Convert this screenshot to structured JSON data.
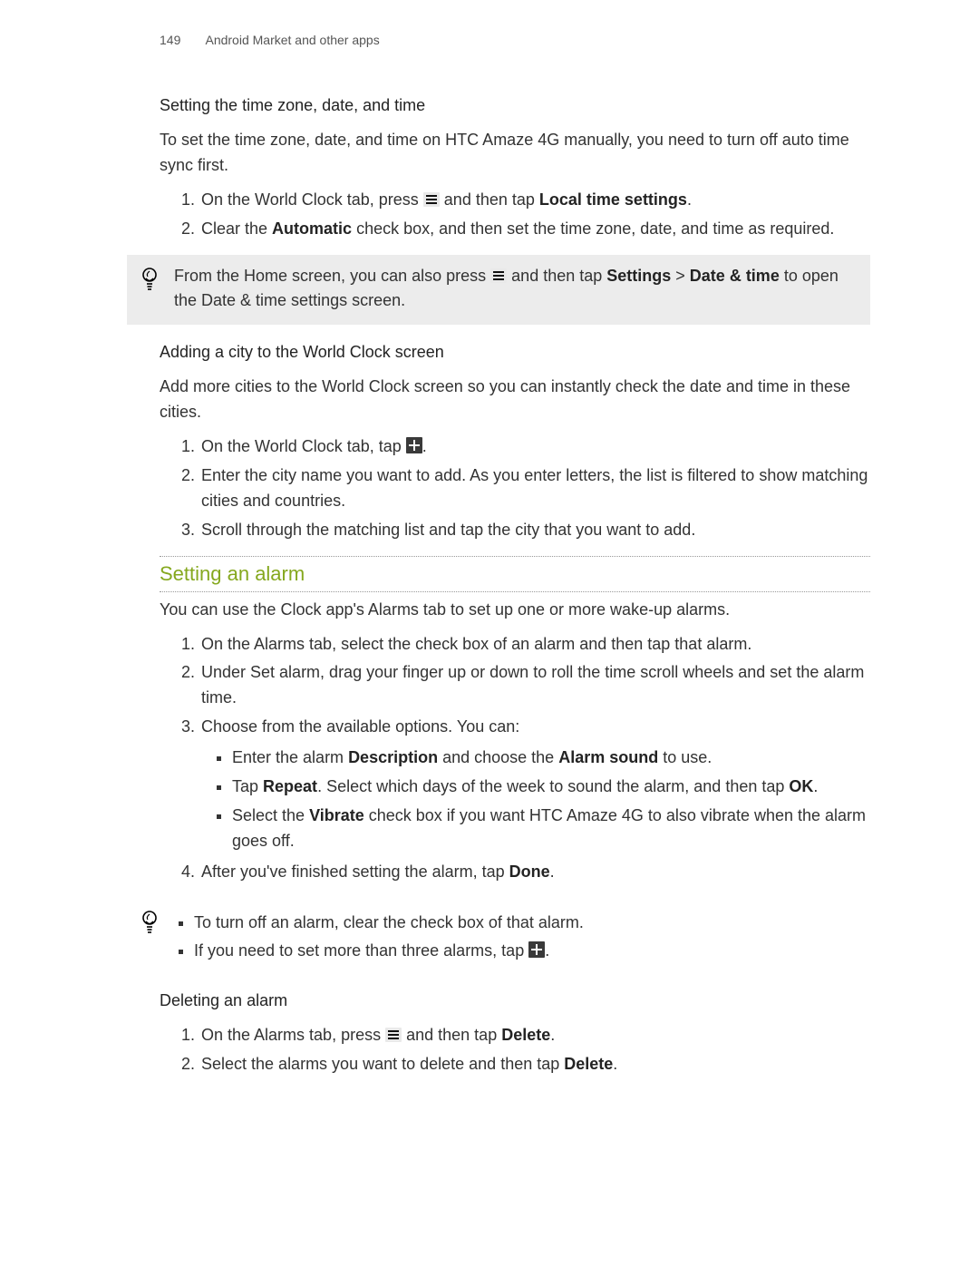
{
  "header": {
    "page_number": "149",
    "section_title": "Android Market and other apps"
  },
  "sec1": {
    "heading": "Setting the time zone, date, and time",
    "intro": "To set the time zone, date, and time on HTC Amaze 4G manually, you need to turn off auto time sync first.",
    "li1_a": "On the World Clock tab, press ",
    "li1_b": " and then tap ",
    "li1_bold": "Local time settings",
    "li1_c": ".",
    "li2_a": "Clear the ",
    "li2_bold": "Automatic",
    "li2_b": " check box, and then set the time zone, date, and time as required."
  },
  "tip1": {
    "a": "From the Home screen, you can also press ",
    "b": " and then tap ",
    "bold1": "Settings",
    "sep": " > ",
    "bold2": "Date & time",
    "c": " to open the Date & time settings screen."
  },
  "sec2": {
    "heading": "Adding a city to the World Clock screen",
    "intro": "Add more cities to the World Clock screen so you can instantly check the date and time in these cities.",
    "li1_a": "On the World Clock tab, tap ",
    "li1_b": ".",
    "li2": "Enter the city name you want to add. As you enter letters, the list is filtered to show matching cities and countries.",
    "li3": "Scroll through the matching list and tap the city that you want to add."
  },
  "sec3": {
    "heading": "Setting an alarm",
    "intro": "You can use the Clock app's Alarms tab to set up one or more wake-up alarms.",
    "li1": "On the Alarms tab, select the check box of an alarm and then tap that alarm.",
    "li2": "Under Set alarm, drag your finger up or down to roll the time scroll wheels and set the alarm time.",
    "li3_lead": "Choose from the available options. You can:",
    "li3_b1_a": "Enter the alarm ",
    "li3_b1_bold1": "Description",
    "li3_b1_b": " and choose the ",
    "li3_b1_bold2": "Alarm sound",
    "li3_b1_c": " to use.",
    "li3_b2_a": "Tap ",
    "li3_b2_bold1": "Repeat",
    "li3_b2_b": ". Select which days of the week to sound the alarm, and then tap ",
    "li3_b2_bold2": "OK",
    "li3_b2_c": ".",
    "li3_b3_a": "Select the ",
    "li3_b3_bold": "Vibrate",
    "li3_b3_b": " check box if you want HTC Amaze 4G to also vibrate when the alarm goes off.",
    "li4_a": "After you've finished setting the alarm, tap ",
    "li4_bold": "Done",
    "li4_b": "."
  },
  "tip2": {
    "b1": "To turn off an alarm, clear the check box of that alarm.",
    "b2_a": "If you need to set more than three alarms, tap ",
    "b2_b": "."
  },
  "sec4": {
    "heading": "Deleting an alarm",
    "li1_a": "On the Alarms tab, press ",
    "li1_b": " and then tap ",
    "li1_bold": "Delete",
    "li1_c": ".",
    "li2_a": "Select the alarms you want to delete and then tap ",
    "li2_bold": "Delete",
    "li2_b": "."
  },
  "icons": {
    "menu": "menu-icon",
    "plus": "plus-icon",
    "bulb": "bulb-icon"
  }
}
